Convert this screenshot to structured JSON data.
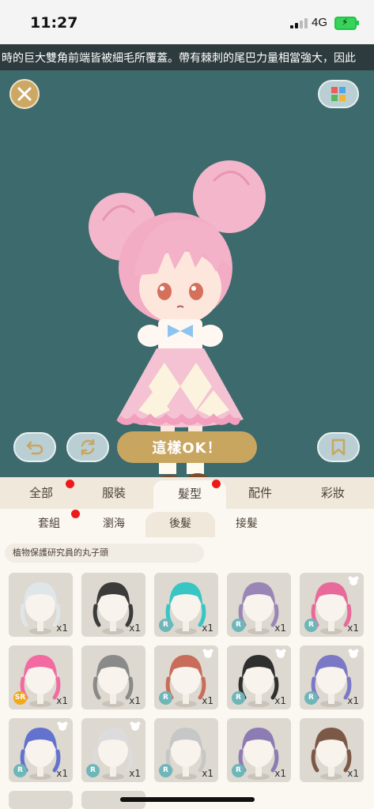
{
  "status": {
    "time": "11:27",
    "network": "4G"
  },
  "ticker": "時的巨大雙角前端皆被細毛所覆蓋。帶有棘刺的尾巴力量相當強大，因此",
  "actions": {
    "ok_label": "這樣OK！"
  },
  "tabs": [
    {
      "label": "全部",
      "badge": true
    },
    {
      "label": "服裝",
      "badge": false
    },
    {
      "label": "髮型",
      "badge": true,
      "active": true
    },
    {
      "label": "配件",
      "badge": false
    },
    {
      "label": "彩妝",
      "badge": false
    }
  ],
  "subtabs": [
    {
      "label": "套組",
      "badge": true
    },
    {
      "label": "瀏海",
      "badge": false
    },
    {
      "label": "後髮",
      "active": true
    },
    {
      "label": "接髮",
      "badge": false
    }
  ],
  "selected_item_name": "植物保護研究員的丸子頭",
  "items": [
    {
      "qty": "x1",
      "rarity": "",
      "hair": "#dfe6ea",
      "new_icon": false
    },
    {
      "qty": "x1",
      "rarity": "",
      "hair": "#3b3b3b",
      "new_icon": false
    },
    {
      "qty": "x1",
      "rarity": "R",
      "hair": "#37c6c4",
      "new_icon": false
    },
    {
      "qty": "x1",
      "rarity": "R",
      "hair": "#9a86b6",
      "new_icon": false
    },
    {
      "qty": "x1",
      "rarity": "R",
      "hair": "#e86a9b",
      "new_icon": true
    },
    {
      "qty": "x1",
      "rarity": "SR",
      "hair": "#f26aa1",
      "new_icon": false
    },
    {
      "qty": "x1",
      "rarity": "",
      "hair": "#8a8a8a",
      "new_icon": false
    },
    {
      "qty": "x1",
      "rarity": "R",
      "hair": "#c86d5a",
      "new_icon": true
    },
    {
      "qty": "x1",
      "rarity": "R",
      "hair": "#2f2f2f",
      "new_icon": true
    },
    {
      "qty": "x1",
      "rarity": "R",
      "hair": "#7b78c6",
      "new_icon": true
    },
    {
      "qty": "x1",
      "rarity": "R",
      "hair": "#6472cf",
      "new_icon": true
    },
    {
      "qty": "x1",
      "rarity": "R",
      "hair": "#dcdcdc",
      "new_icon": true
    },
    {
      "qty": "x1",
      "rarity": "R",
      "hair": "#c7c7c7",
      "new_icon": false
    },
    {
      "qty": "x1",
      "rarity": "R",
      "hair": "#8d7cb3",
      "new_icon": false
    },
    {
      "qty": "x1",
      "rarity": "",
      "hair": "#7c5846",
      "new_icon": false
    }
  ]
}
